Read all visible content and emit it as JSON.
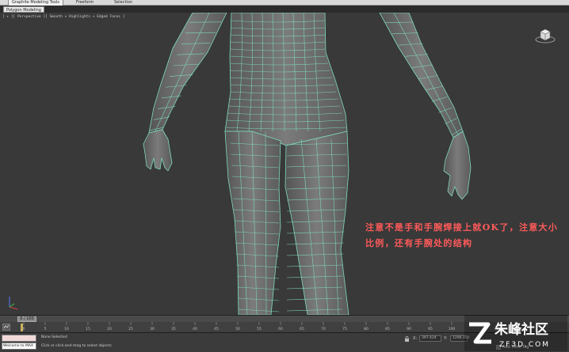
{
  "ribbon": {
    "tabs": [
      "Graphite Modeling Tools",
      "Freeform",
      "Selection"
    ],
    "active_sub": "Polygon Modeling"
  },
  "viewport": {
    "label": "[ + ][ Perspective ][ Smooth + Highlights + Edged Faces ]",
    "annotation_line1": "注意不是手和手腕焊接上就OK了，注意大小",
    "annotation_line2": "比例，还有手腕处的结构",
    "annotation_color": "#ff5a5a",
    "wire_color": "#7fd9c0"
  },
  "timeline": {
    "slider_label": "0 / 100",
    "ticks": [
      "0",
      "5",
      "10",
      "15",
      "20",
      "25",
      "30",
      "35",
      "40",
      "45",
      "50",
      "55",
      "60",
      "65",
      "70",
      "75",
      "80",
      "85",
      "90",
      "95",
      "100"
    ]
  },
  "statusbar": {
    "welcome": "Welcome to MAX",
    "selection_status": "None Selected",
    "prompt": "Click or click-and-drag to select objects",
    "x_label": "X:",
    "x_value": "397.424",
    "y_label": "Y:",
    "y_value": "1296.104",
    "add_time_tag": "Add Time Tag"
  },
  "watermark": {
    "brand": "朱峰社区",
    "site": "ZF3D.COM"
  }
}
